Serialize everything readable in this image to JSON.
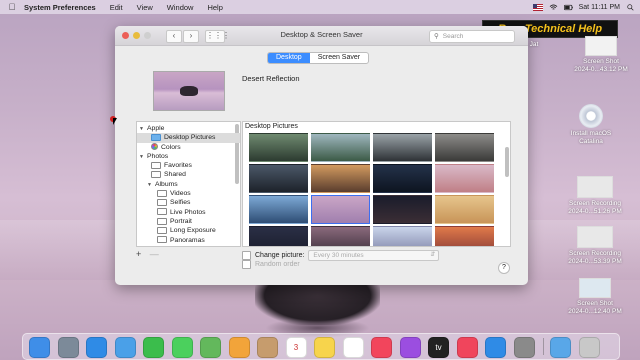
{
  "menubar": {
    "app_name": "System Preferences",
    "items": [
      "Edit",
      "View",
      "Window",
      "Help"
    ],
    "clock": "Sat 11:11 PM"
  },
  "watermark": "Ram Technical Help",
  "window": {
    "title": "Desktop & Screen Saver",
    "search_placeholder": "Search",
    "tabs": [
      {
        "label": "Desktop",
        "active": true
      },
      {
        "label": "Screen Saver",
        "active": false
      }
    ],
    "current_picture": "Desert Reflection",
    "sources": [
      {
        "label": "Apple",
        "type": "group",
        "expanded": true
      },
      {
        "label": "Desktop Pictures",
        "type": "folder",
        "selected": true
      },
      {
        "label": "Colors",
        "type": "colors"
      },
      {
        "label": "Photos",
        "type": "group",
        "expanded": true
      },
      {
        "label": "Favorites",
        "type": "heart"
      },
      {
        "label": "Shared",
        "type": "cloud"
      },
      {
        "label": "Albums",
        "type": "group-sub",
        "expanded": true
      },
      {
        "label": "Videos",
        "type": "album"
      },
      {
        "label": "Selfies",
        "type": "album"
      },
      {
        "label": "Live Photos",
        "type": "album"
      },
      {
        "label": "Portrait",
        "type": "album"
      },
      {
        "label": "Long Exposure",
        "type": "album"
      },
      {
        "label": "Panoramas",
        "type": "album"
      }
    ],
    "grid_title": "Desktop Pictures",
    "thumbnails": [
      {
        "color_top": "#6f8a70",
        "color_bottom": "#2c3b30"
      },
      {
        "color_top": "#9fb7bf",
        "color_bottom": "#3b5a46"
      },
      {
        "color_top": "#9aa3a8",
        "color_bottom": "#2e3236"
      },
      {
        "color_top": "#8d8c89",
        "color_bottom": "#3a3a38"
      },
      {
        "color_top": "#4b5868",
        "color_bottom": "#1d222a"
      },
      {
        "color_top": "#d29a5f",
        "color_bottom": "#5a3d2e"
      },
      {
        "color_top": "#24324a",
        "color_bottom": "#0d1420"
      },
      {
        "color_top": "#d9b9c8",
        "color_bottom": "#c07f86"
      },
      {
        "color_top": "#7da9d6",
        "color_bottom": "#2e4d74"
      },
      {
        "color_top": "#caa6c6",
        "color_bottom": "#a07fae",
        "selected": true
      },
      {
        "color_top": "#1a1c2b",
        "color_bottom": "#3b2e35"
      },
      {
        "color_top": "#e6c58c",
        "color_bottom": "#c89458"
      },
      {
        "color_top": "#2a2f45",
        "color_bottom": "#1a1c2c"
      },
      {
        "color_top": "#8a6a7c",
        "color_bottom": "#3d2f3c"
      },
      {
        "color_top": "#c9d4ea",
        "color_bottom": "#7f84a8"
      },
      {
        "color_top": "#e07a4a",
        "color_bottom": "#8a3b36"
      }
    ],
    "add_label": "+",
    "remove_label": "—",
    "change_picture_label": "Change picture:",
    "change_interval": "Every 30 minutes",
    "random_order_label": "Random order",
    "help_label": "?"
  },
  "desktop_icons": [
    {
      "label": "Screen Shot\n2024-0...43.12 PM"
    },
    {
      "label": "Install macOS\nCatalina"
    },
    {
      "label": "Screen Recording\n2024-0...51.26 PM"
    },
    {
      "label": "Screen Recording\n2024-0...53.39 PM"
    },
    {
      "label": "Screen Shot\n2024-0...12.40 PM"
    }
  ],
  "desktop_partial_label": "Jat",
  "dock": {
    "apps": [
      {
        "name": "finder-icon",
        "color": "#3f8ee8"
      },
      {
        "name": "launchpad-icon",
        "color": "#7c8a99"
      },
      {
        "name": "safari-icon",
        "color": "#2f8be6"
      },
      {
        "name": "mail-icon",
        "color": "#4aa0e8"
      },
      {
        "name": "facetime-icon",
        "color": "#3bbd4c"
      },
      {
        "name": "messages-icon",
        "color": "#4bd05d"
      },
      {
        "name": "maps-icon",
        "color": "#63b85c"
      },
      {
        "name": "photos-icon",
        "color": "#f2a43a"
      },
      {
        "name": "contacts-icon",
        "color": "#c69c6d"
      },
      {
        "name": "calendar-icon",
        "color": "#ffffff",
        "text": "3"
      },
      {
        "name": "notes-icon",
        "color": "#f7d44c"
      },
      {
        "name": "reminders-icon",
        "color": "#ffffff"
      },
      {
        "name": "music-icon",
        "color": "#f2455c"
      },
      {
        "name": "podcasts-icon",
        "color": "#9b4ee0"
      },
      {
        "name": "tv-icon",
        "color": "#222222",
        "text": "tv"
      },
      {
        "name": "news-icon",
        "color": "#f0455c"
      },
      {
        "name": "app-store-icon",
        "color": "#2f8be6"
      },
      {
        "name": "system-preferences-icon",
        "color": "#8a8a8a"
      },
      {
        "name": "folder-icon",
        "color": "#59a7e8"
      },
      {
        "name": "trash-icon",
        "color": "#c8c8c8"
      }
    ]
  }
}
